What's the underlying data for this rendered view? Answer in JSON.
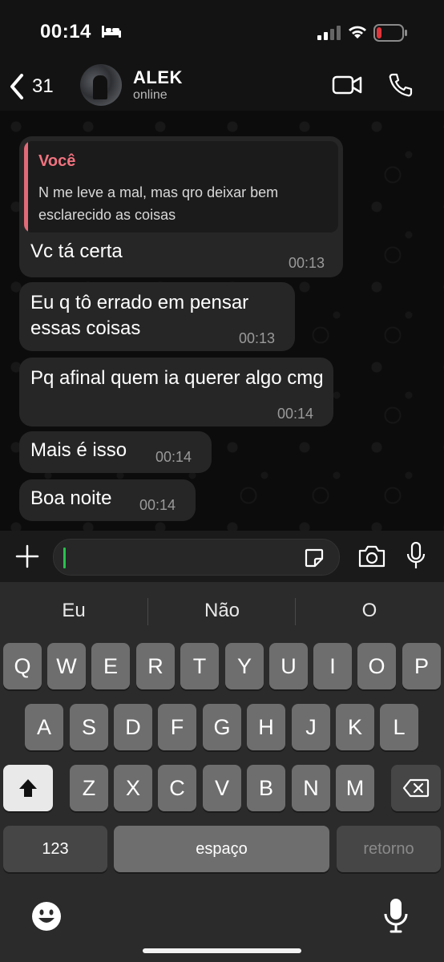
{
  "status_bar": {
    "time": "00:14"
  },
  "header": {
    "back_count": "31",
    "contact_name": "ALEK",
    "contact_status": "online"
  },
  "messages": [
    {
      "quote": {
        "author": "Você",
        "text": "N me leve a mal, mas qro deixar bem esclarecido as coisas"
      },
      "text": "Vc tá certa",
      "time": "00:13"
    },
    {
      "text": "Eu q tô errado em pensar essas coisas",
      "time": "00:13"
    },
    {
      "text": "Pq afinal quem ia querer algo cmg",
      "time": "00:14"
    },
    {
      "text": "Mais é isso",
      "time": "00:14"
    },
    {
      "text": "Boa noite",
      "time": "00:14"
    }
  ],
  "input": {
    "placeholder": ""
  },
  "keyboard": {
    "suggestions": [
      "Eu",
      "Não",
      "O"
    ],
    "row1": [
      "Q",
      "W",
      "E",
      "R",
      "T",
      "Y",
      "U",
      "I",
      "O",
      "P"
    ],
    "row2": [
      "A",
      "S",
      "D",
      "F",
      "G",
      "H",
      "J",
      "K",
      "L"
    ],
    "row3": [
      "Z",
      "X",
      "C",
      "V",
      "B",
      "N",
      "M"
    ],
    "numbers_label": "123",
    "space_label": "espaço",
    "return_label": "retorno"
  },
  "icons": {
    "sleep_focus": "bed-icon",
    "signal": "signal-icon",
    "wifi": "wifi-icon",
    "battery": "battery-icon",
    "back": "chevron-left-icon",
    "video": "video-camera-icon",
    "call": "phone-icon",
    "attach": "plus-icon",
    "sticker": "sticker-icon",
    "camera": "camera-icon",
    "mic": "microphone-icon",
    "shift": "shift-icon",
    "delete": "backspace-icon",
    "emoji": "emoji-icon",
    "dictation": "microphone-icon"
  },
  "colors": {
    "quote_accent": "#e26a78",
    "caret": "#27c24c",
    "bubble": "#262626",
    "battery_low": "#e0353b"
  }
}
